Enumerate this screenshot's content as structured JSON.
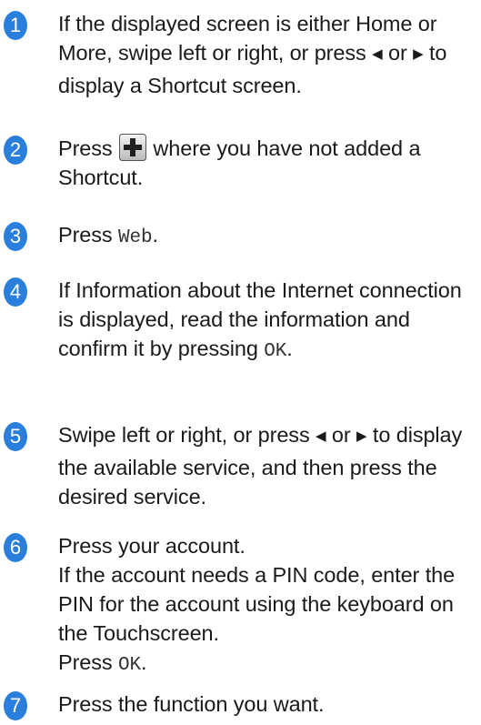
{
  "accent_color": "#2b7fdc",
  "steps": [
    {
      "number": "1",
      "text_a": "If the displayed screen is either Home or More, swipe left or right, or press ",
      "arrow_left": "◀",
      "text_b": " or ",
      "arrow_right": "▶",
      "text_c": " to display a Shortcut screen."
    },
    {
      "number": "2",
      "text_a": "Press ",
      "icon": "plus-button-icon",
      "text_b": " where you have not added a Shortcut."
    },
    {
      "number": "3",
      "text_a": "Press ",
      "mono": "Web",
      "text_b": "."
    },
    {
      "number": "4",
      "text_a": "If Information about the Internet connection is displayed, read the information and confirm it by pressing ",
      "mono": "OK",
      "text_b": "."
    },
    {
      "number": "5",
      "text_a": "Swipe left or right, or press ",
      "arrow_left": "◀",
      "text_b": " or ",
      "arrow_right": "▶",
      "text_c": " to display the available service, and then press the desired service."
    },
    {
      "number": "6",
      "line1": "Press your account.",
      "line2": "If the account needs a PIN code, enter the PIN for the account using the keyboard on the Touchscreen.",
      "line3_a": "Press ",
      "line3_mono": "OK",
      "line3_b": "."
    },
    {
      "number": "7",
      "text_a": "Press the function you want."
    }
  ]
}
